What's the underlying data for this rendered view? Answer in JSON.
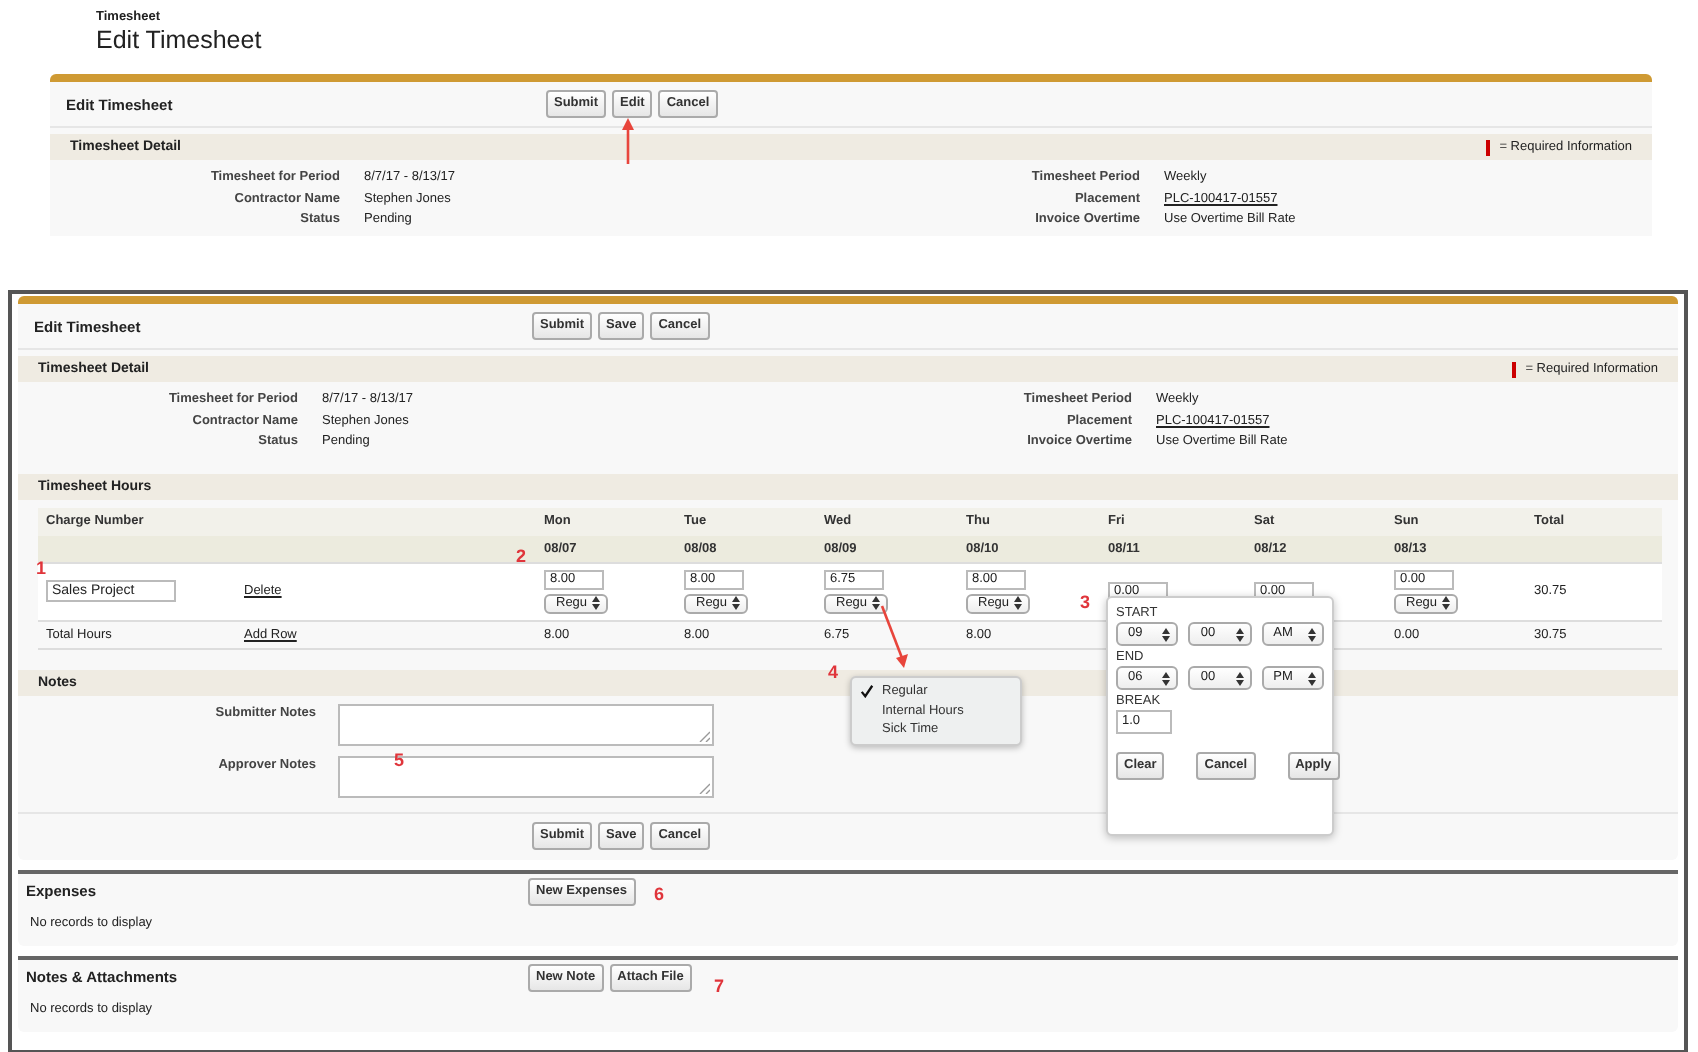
{
  "header": {
    "breadcrumb": "Timesheet",
    "title": "Edit Timesheet"
  },
  "view_panel": {
    "title": "Edit Timesheet",
    "buttons": [
      "Submit",
      "Edit",
      "Cancel"
    ],
    "detail_title": "Timesheet Detail",
    "required_legend": "= Required Information",
    "fields_left": [
      {
        "label": "Timesheet for Period",
        "value": "8/7/17 - 8/13/17",
        "kind": "text"
      },
      {
        "label": "Contractor Name",
        "value": "Stephen Jones",
        "kind": "text"
      },
      {
        "label": "Status",
        "value": "Pending",
        "kind": "text"
      }
    ],
    "fields_right": [
      {
        "label": "Timesheet Period",
        "value": "Weekly",
        "kind": "text"
      },
      {
        "label": "Placement",
        "value": "PLC-100417-01557",
        "kind": "link"
      },
      {
        "label": "Invoice Overtime",
        "value": "Use Overtime Bill Rate",
        "kind": "text"
      }
    ]
  },
  "edit_panel": {
    "title": "Edit Timesheet",
    "buttons": [
      "Submit",
      "Save",
      "Cancel"
    ],
    "detail_title": "Timesheet Detail",
    "required_legend": "= Required Information",
    "fields_left": [
      {
        "label": "Timesheet for Period",
        "value": "8/7/17 - 8/13/17",
        "kind": "text"
      },
      {
        "label": "Contractor Name",
        "value": "Stephen Jones",
        "kind": "text"
      },
      {
        "label": "Status",
        "value": "Pending",
        "kind": "text"
      }
    ],
    "fields_right": [
      {
        "label": "Timesheet Period",
        "value": "Weekly",
        "kind": "text"
      },
      {
        "label": "Placement",
        "value": "PLC-100417-01557",
        "kind": "link"
      },
      {
        "label": "Invoice Overtime",
        "value": "Use Overtime Bill Rate",
        "kind": "text"
      }
    ],
    "hours": {
      "title": "Timesheet Hours",
      "charge_header": "Charge Number",
      "total_header": "Total",
      "days": [
        {
          "day": "Mon",
          "date": "08/07",
          "hours": "8.00",
          "type": "Regu",
          "total": "8.00"
        },
        {
          "day": "Tue",
          "date": "08/08",
          "hours": "8.00",
          "type": "Regu",
          "total": "8.00"
        },
        {
          "day": "Wed",
          "date": "08/09",
          "hours": "6.75",
          "type": "Regu",
          "total": "6.75"
        },
        {
          "day": "Thu",
          "date": "08/10",
          "hours": "8.00",
          "type": "Regu",
          "total": "8.00"
        },
        {
          "day": "Fri",
          "date": "08/11",
          "hours": "0.00"
        },
        {
          "day": "Sat",
          "date": "08/12",
          "hours": "0.00"
        },
        {
          "day": "Sun",
          "date": "08/13",
          "hours": "0.00",
          "type": "Regu",
          "total": "0.00"
        }
      ],
      "row": {
        "charge": "Sales Project",
        "action": "Delete",
        "total": "30.75"
      },
      "totals_row": {
        "label": "Total Hours",
        "action": "Add Row",
        "total": "30.75"
      }
    },
    "notes": {
      "title": "Notes",
      "fields": [
        {
          "label": "Submitter Notes"
        },
        {
          "label": "Approver Notes"
        }
      ]
    },
    "bottom_buttons": [
      "Submit",
      "Save",
      "Cancel"
    ]
  },
  "related": [
    {
      "title": "Expenses",
      "buttons": [
        "New Expenses"
      ],
      "empty": "No records to display"
    },
    {
      "title": "Notes & Attachments",
      "buttons": [
        "New Note",
        "Attach File"
      ],
      "empty": "No records to display"
    }
  ],
  "type_menu": {
    "options": [
      {
        "label": "Regular",
        "selected": true
      },
      {
        "label": "Internal Hours",
        "selected": false
      },
      {
        "label": "Sick Time",
        "selected": false
      }
    ]
  },
  "time_popup": {
    "start_label": "START",
    "start": [
      "09",
      "00",
      "AM"
    ],
    "end_label": "END",
    "end": [
      "06",
      "00",
      "PM"
    ],
    "break_label": "BREAK",
    "break": "1.0",
    "buttons": [
      "Clear",
      "Cancel",
      "Apply"
    ]
  },
  "annotations": [
    "1",
    "2",
    "3",
    "4",
    "5",
    "6",
    "7"
  ]
}
